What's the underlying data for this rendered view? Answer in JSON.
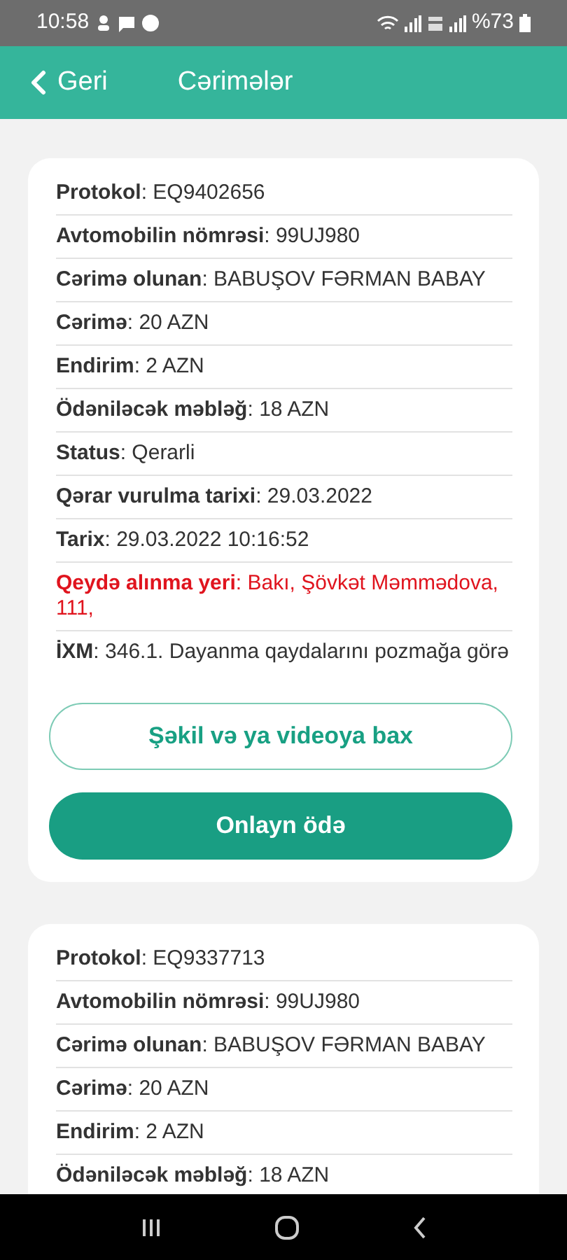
{
  "status_bar": {
    "time": "10:58",
    "battery": "%73"
  },
  "header": {
    "back": "Geri",
    "title": "Cərimələr"
  },
  "fines": [
    {
      "rows": [
        {
          "text": "**Protokol**: EQ9402656",
          "alert": false
        },
        {
          "text": "**Avtomobilin nömrəsi**: 99UJ980",
          "alert": false
        },
        {
          "text": "**Cərimə olunan**: BABUŞOV FƏRMAN BABAY",
          "alert": false
        },
        {
          "text": "**Cərimə**: 20 AZN",
          "alert": false
        },
        {
          "text": "**Endirim**: 2 AZN",
          "alert": false
        },
        {
          "text": "**Ödəniləcək məbləğ**: 18 AZN",
          "alert": false
        },
        {
          "text": "**Status**: Qerarli",
          "alert": false
        },
        {
          "text": "**Qərar vurulma tarixi**: 29.03.2022",
          "alert": false
        },
        {
          "text": "**Tarix**: 29.03.2022 10:16:52",
          "alert": false
        },
        {
          "text": "**Qeydə alınma yeri**: Bakı, Şövkət Məmmədova, 111,",
          "alert": true
        },
        {
          "text": "**İXM**: 346.1. Dayanma qaydalarını pozmağa görə",
          "alert": false
        }
      ],
      "buttons": [
        {
          "label": "Şəkil və ya videoya bax",
          "kind": "outline"
        },
        {
          "label": "Onlayn ödə",
          "kind": "filled"
        }
      ]
    },
    {
      "rows": [
        {
          "text": "**Protokol**: EQ9337713",
          "alert": false
        },
        {
          "text": "**Avtomobilin nömrəsi**: 99UJ980",
          "alert": false
        },
        {
          "text": "**Cərimə olunan**: BABUŞOV FƏRMAN BABAY",
          "alert": false
        },
        {
          "text": "**Cərimə**: 20 AZN",
          "alert": false
        },
        {
          "text": "**Endirim**: 2 AZN",
          "alert": false
        },
        {
          "text": "**Ödəniləcək məbləğ**: 18 AZN",
          "alert": false
        }
      ]
    }
  ]
}
